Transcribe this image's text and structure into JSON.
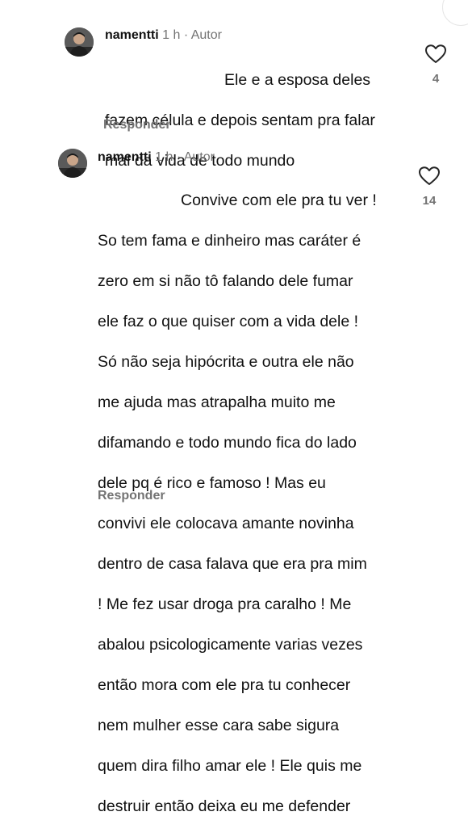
{
  "comments": [
    {
      "username": "namentti",
      "time": "1 h",
      "author_label": "Autor",
      "text_lines": [
        "Ele e a esposa deles",
        "fazem célula e depois sentam pra falar",
        "mal da vida de todo mundo"
      ],
      "likes": "4",
      "reply_label": "Responder"
    },
    {
      "username": "namentti",
      "time": "1 h",
      "author_label": "Autor",
      "text_lines": [
        "Convive com ele pra tu ver !",
        "So tem fama e dinheiro mas caráter é",
        "zero em si não tô falando dele fumar",
        "ele faz o que quiser com a vida dele !",
        "Só não seja hipócrita e outra ele não",
        "me ajuda mas atrapalha muito me",
        "difamando e todo mundo fica do lado",
        "dele pq é rico e famoso ! Mas eu",
        "convivi ele colocava amante novinha",
        "dentro de casa falava que era pra mim",
        "! Me fez usar droga pra caralho ! Me",
        "abalou psicologicamente varias vezes",
        "então mora com ele pra tu conhecer",
        "nem mulher esse cara sabe sigura",
        "quem dira filho amar ele ! Ele quis me",
        "destruir então deixa eu me defender"
      ],
      "likes": "14",
      "reply_label": "Responder"
    }
  ],
  "icons": {
    "like": "heart-outline-icon",
    "avatar": "profile-photo"
  },
  "colors": {
    "text": "#111111",
    "secondary": "#737373",
    "background": "#ffffff"
  }
}
